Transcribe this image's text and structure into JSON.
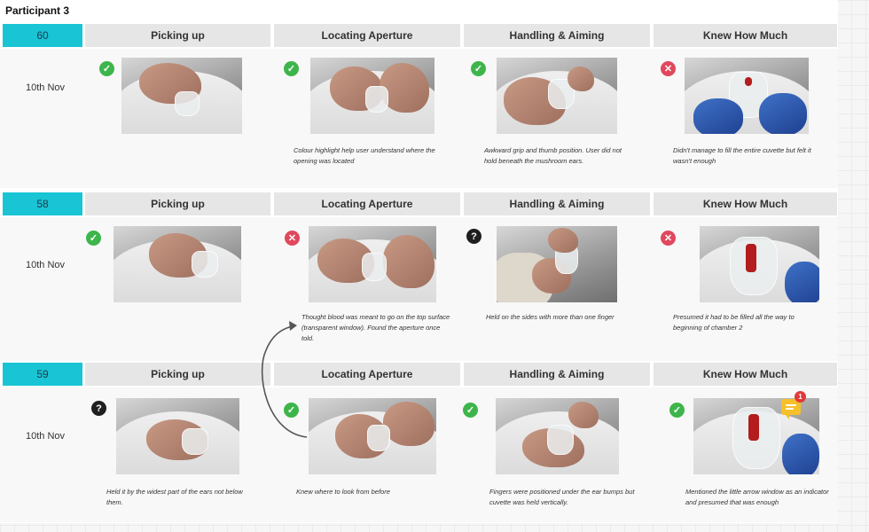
{
  "title": "Participant 3",
  "columns": [
    "Picking up",
    "Locating Aperture",
    "Handling & Aiming",
    "Knew How Much"
  ],
  "rows": [
    {
      "id": "60",
      "date": "10th Nov",
      "cells": [
        {
          "status": "pass",
          "status_icon": "check-circle-icon",
          "note": ""
        },
        {
          "status": "pass",
          "status_icon": "check-circle-icon",
          "note": "Colour highlight help user understand where the opening was located"
        },
        {
          "status": "pass",
          "status_icon": "check-circle-icon",
          "note": "Awkward grip and thumb position. User did not hold beneath the mushroom ears."
        },
        {
          "status": "fail",
          "status_icon": "cross-circle-icon",
          "note": "Didn't manage to fill the entire cuvette but felt it wasn't enough"
        }
      ]
    },
    {
      "id": "58",
      "date": "10th Nov",
      "cells": [
        {
          "status": "pass",
          "status_icon": "check-circle-icon",
          "note": ""
        },
        {
          "status": "fail",
          "status_icon": "cross-circle-icon",
          "note": "Thought blood was meant to go on the top surface (transparent window). Found the aperture once told."
        },
        {
          "status": "unsure",
          "status_icon": "question-circle-icon",
          "note": "Held on the sides with more than one finger"
        },
        {
          "status": "fail",
          "status_icon": "cross-circle-icon",
          "note": "Presumed it had to be filled all the way to beginning of chamber 2"
        }
      ]
    },
    {
      "id": "59",
      "date": "10th Nov",
      "cells": [
        {
          "status": "unsure",
          "status_icon": "question-circle-icon",
          "note": "Held it by the widest part of the ears not below them."
        },
        {
          "status": "pass",
          "status_icon": "check-circle-icon",
          "note": "Knew where to look from before"
        },
        {
          "status": "pass",
          "status_icon": "check-circle-icon",
          "note": "Fingers were positioned under the ear bumps but cuvette was held vertically."
        },
        {
          "status": "pass",
          "status_icon": "check-circle-icon",
          "note": "Mentioned the little arrow window as an indicator and presumed that was enough"
        }
      ]
    }
  ],
  "comment": {
    "icon": "comment-icon",
    "count": "1"
  },
  "colors": {
    "id_tag": "#19c4d4",
    "header_bg": "#e6e6e6",
    "pass": "#3eb54b",
    "fail": "#e0485d",
    "unsure": "#1f1f1f",
    "comment": "#f5c02a",
    "badge": "#e23838"
  }
}
